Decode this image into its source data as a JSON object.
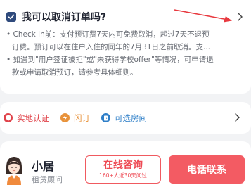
{
  "faq": {
    "title": "我可以取消订单吗?",
    "lines": [
      "• Check in前：支付预订费7天内可免费取消，超过7天不退预",
      "订费。预订可以在住户入住的同年的7月31日之前取消。支...",
      "• 如遇到\"用户签证被拒\"或\"未获得学校offer\"等情况，可申请退",
      "款或申请取消预订，请参考具体细则。"
    ],
    "icons": {
      "check": "checkbox-checked-icon",
      "more": "chevron-right-icon",
      "annotation": "red-arrow-annotation"
    },
    "colors": {
      "check": "#2f4a7c",
      "arrow": "#e8393f"
    }
  },
  "tags": {
    "items": [
      {
        "label": "实地认证",
        "icon": "shield-icon",
        "color": "#e0434a"
      },
      {
        "label": "闪订",
        "icon": "lightning-icon",
        "color": "#e8923a"
      },
      {
        "label": "可选房间",
        "icon": "door-icon",
        "color": "#2f7fc8"
      }
    ],
    "chevron": "chevron-right-icon"
  },
  "bottom": {
    "name": "小居",
    "role": "租赁顾问",
    "chat_label": "在线咨询",
    "chat_sub": "160+人近30天问过",
    "call_label": "电话联系",
    "colors": {
      "accent": "#f35b63"
    }
  }
}
